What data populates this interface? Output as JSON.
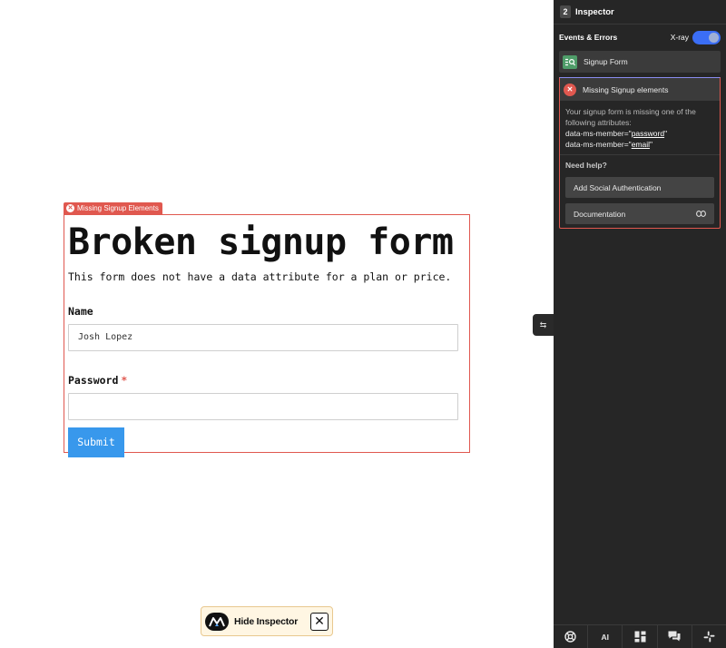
{
  "form": {
    "error_tag": "Missing Signup Elements",
    "title": "Broken signup form",
    "description": "This form does not have a data attribute for a plan or price.",
    "name_label": "Name",
    "name_value": "Josh Lopez",
    "password_label": "Password",
    "required_mark": "*",
    "password_value": "",
    "submit_label": "Submit"
  },
  "collapse_handle": {
    "icon": "⇆"
  },
  "hide_inspector": {
    "label": "Hide Inspector",
    "close_icon": "✕"
  },
  "inspector": {
    "count": "2",
    "title": "Inspector",
    "events_label": "Events & Errors",
    "xray_label": "X-ray",
    "xray_on": true,
    "signup_form_label": "Signup Form",
    "error_title": "Missing Signup elements",
    "error_message": "Your signup form is missing one of the following attributes:",
    "attr_prefix": "data-ms-member=\"",
    "attr_suffix": "\"",
    "attributes": [
      "password",
      "email"
    ],
    "help_label": "Need help?",
    "help_buttons": [
      "Add Social Authentication",
      "Documentation"
    ],
    "footer_ai": "AI"
  },
  "colors": {
    "error": "#e0584f",
    "accent": "#3b6ef6",
    "submit": "#3898ec",
    "panel_bg": "#262626"
  }
}
